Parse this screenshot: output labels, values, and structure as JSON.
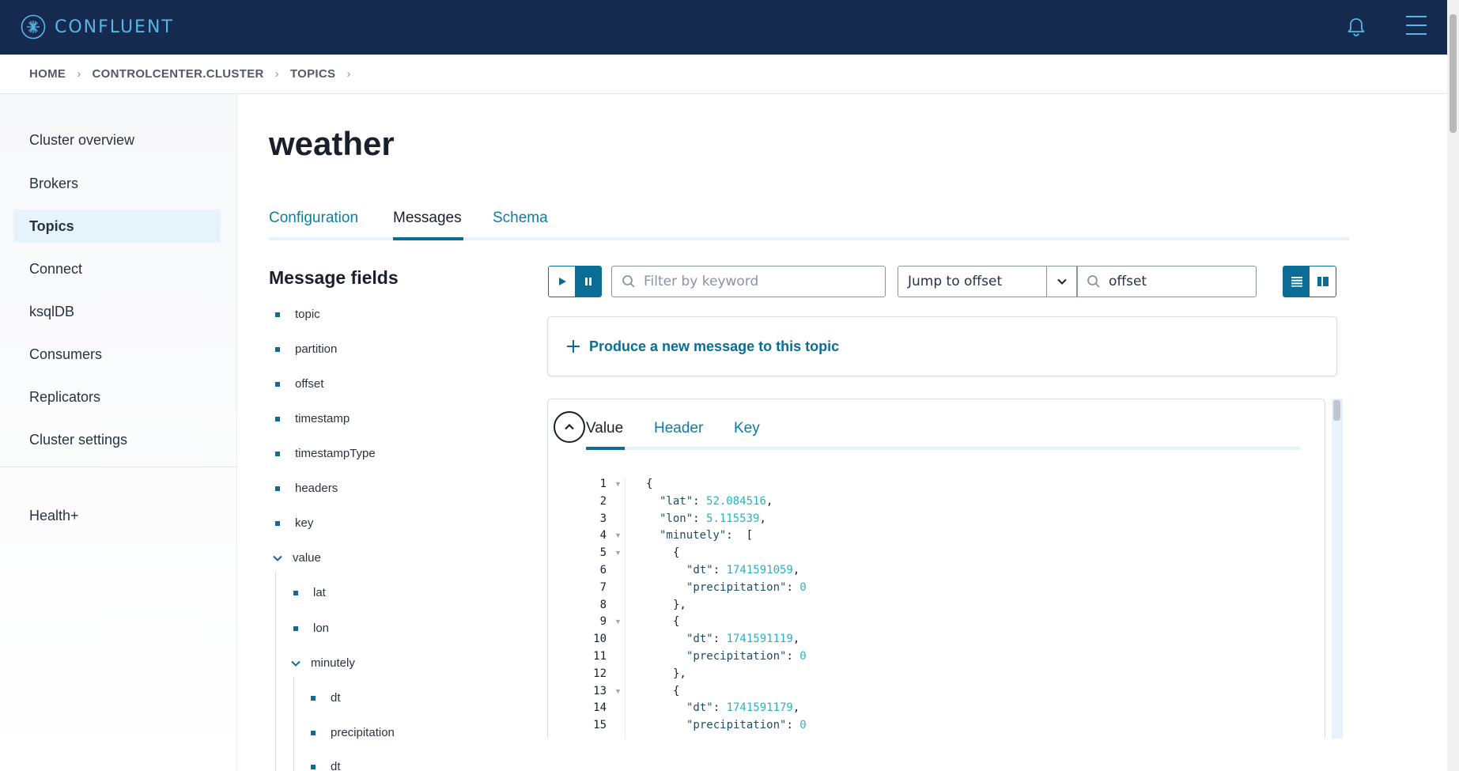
{
  "brand": {
    "name": "CONFLUENT"
  },
  "breadcrumb": {
    "items": [
      "HOME",
      "CONTROLCENTER.CLUSTER",
      "TOPICS"
    ],
    "separator": "›"
  },
  "sidebar": {
    "items": [
      "Cluster overview",
      "Brokers",
      "Topics",
      "Connect",
      "ksqlDB",
      "Consumers",
      "Replicators",
      "Cluster settings"
    ],
    "active": "Topics",
    "extra": "Health+"
  },
  "page": {
    "title": "weather"
  },
  "tabs": {
    "items": [
      "Configuration",
      "Messages",
      "Schema"
    ],
    "active": "Messages"
  },
  "message_fields": {
    "title": "Message fields",
    "fields": [
      "topic",
      "partition",
      "offset",
      "timestamp",
      "timestampType",
      "headers",
      "key"
    ],
    "value": {
      "label": "value",
      "children": [
        "lat",
        "lon"
      ],
      "minutely": {
        "label": "minutely",
        "children": [
          "dt",
          "precipitation",
          "dt"
        ]
      }
    }
  },
  "controls": {
    "filter_placeholder": "Filter by keyword",
    "jump_label": "Jump to offset",
    "offset_value": "offset"
  },
  "produce": {
    "label": "Produce a new message to this topic"
  },
  "message": {
    "tabs": [
      "Value",
      "Header",
      "Key"
    ],
    "active_tab": "Value",
    "lines": [
      {
        "n": "1",
        "fold": true,
        "indent": 0,
        "text": "{"
      },
      {
        "n": "2",
        "fold": false,
        "indent": 1,
        "key": "\"lat\"",
        "val": "52.084516",
        "tail": ","
      },
      {
        "n": "3",
        "fold": false,
        "indent": 1,
        "key": "\"lon\"",
        "val": "5.115539",
        "tail": ","
      },
      {
        "n": "4",
        "fold": true,
        "indent": 1,
        "key": "\"minutely\"",
        "val": "",
        "tail": " ["
      },
      {
        "n": "5",
        "fold": true,
        "indent": 2,
        "text": "{"
      },
      {
        "n": "6",
        "fold": false,
        "indent": 3,
        "key": "\"dt\"",
        "val": "1741591059",
        "tail": ","
      },
      {
        "n": "7",
        "fold": false,
        "indent": 3,
        "key": "\"precipitation\"",
        "val": "0",
        "tail": ""
      },
      {
        "n": "8",
        "fold": false,
        "indent": 2,
        "text": "},"
      },
      {
        "n": "9",
        "fold": true,
        "indent": 2,
        "text": "{"
      },
      {
        "n": "10",
        "fold": false,
        "indent": 3,
        "key": "\"dt\"",
        "val": "1741591119",
        "tail": ","
      },
      {
        "n": "11",
        "fold": false,
        "indent": 3,
        "key": "\"precipitation\"",
        "val": "0",
        "tail": ""
      },
      {
        "n": "12",
        "fold": false,
        "indent": 2,
        "text": "},"
      },
      {
        "n": "13",
        "fold": true,
        "indent": 2,
        "text": "{"
      },
      {
        "n": "14",
        "fold": false,
        "indent": 3,
        "key": "\"dt\"",
        "val": "1741591179",
        "tail": ","
      },
      {
        "n": "15",
        "fold": false,
        "indent": 3,
        "key": "\"precipitation\"",
        "val": "0",
        "tail": ""
      }
    ]
  },
  "colors": {
    "topbar": "#152a4e",
    "accent": "#0a6d96",
    "link": "#0a7ea4",
    "brand": "#56b6e6",
    "number": "#28b3c4"
  },
  "icons": [
    "confluent-logo-icon",
    "bell-icon",
    "hamburger-menu-icon",
    "play-icon",
    "pause-icon",
    "search-icon",
    "chevron-down-icon",
    "list-view-icon",
    "split-view-icon",
    "plus-icon",
    "chevron-up-icon"
  ]
}
